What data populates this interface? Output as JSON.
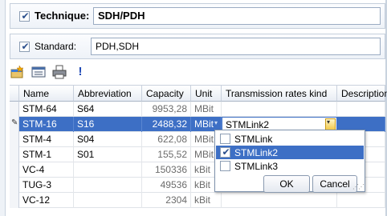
{
  "technique": {
    "label": "Technique:",
    "value": "SDH/PDH",
    "checked": true
  },
  "standard": {
    "label": "Standard:",
    "value": "PDH,SDH",
    "checked": true
  },
  "toolbar": {
    "icons": [
      "new-row-icon",
      "print-preview-icon",
      "print-icon",
      "exclamation-icon"
    ],
    "exclamation": "!"
  },
  "grid": {
    "columns": [
      "Name",
      "Abbreviation",
      "Capacity",
      "Unit",
      "Transmission rates kind",
      "Description"
    ],
    "rows": [
      {
        "name": "STM-64",
        "abbr": "S64",
        "capacity": "9953,28",
        "unit": "MBit",
        "kind": "",
        "desc": ""
      },
      {
        "name": "STM-16",
        "abbr": "S16",
        "capacity": "2488,32",
        "unit": "MBit",
        "kind": "STMLink2",
        "desc": "",
        "selected": true
      },
      {
        "name": "STM-4",
        "abbr": "S04",
        "capacity": "622,08",
        "unit": "MBit",
        "kind": "",
        "desc": ""
      },
      {
        "name": "STM-1",
        "abbr": "S01",
        "capacity": "155,52",
        "unit": "MBit",
        "kind": "",
        "desc": ""
      },
      {
        "name": "VC-4",
        "abbr": "",
        "capacity": "150336",
        "unit": "kBit",
        "kind": "",
        "desc": ""
      },
      {
        "name": "TUG-3",
        "abbr": "",
        "capacity": "49536",
        "unit": "kBit",
        "kind": "",
        "desc": ""
      },
      {
        "name": "VC-12",
        "abbr": "",
        "capacity": "2304",
        "unit": "kBit",
        "kind": "",
        "desc": ""
      }
    ]
  },
  "dropdown": {
    "options": [
      {
        "label": "STMLink",
        "checked": false
      },
      {
        "label": "STMLink2",
        "checked": true
      },
      {
        "label": "STMLink3",
        "checked": false
      }
    ],
    "ok_label": "OK",
    "cancel_label": "Cancel"
  },
  "colors": {
    "selection": "#3d6fc5",
    "accent_icon": "#1f49b6"
  }
}
